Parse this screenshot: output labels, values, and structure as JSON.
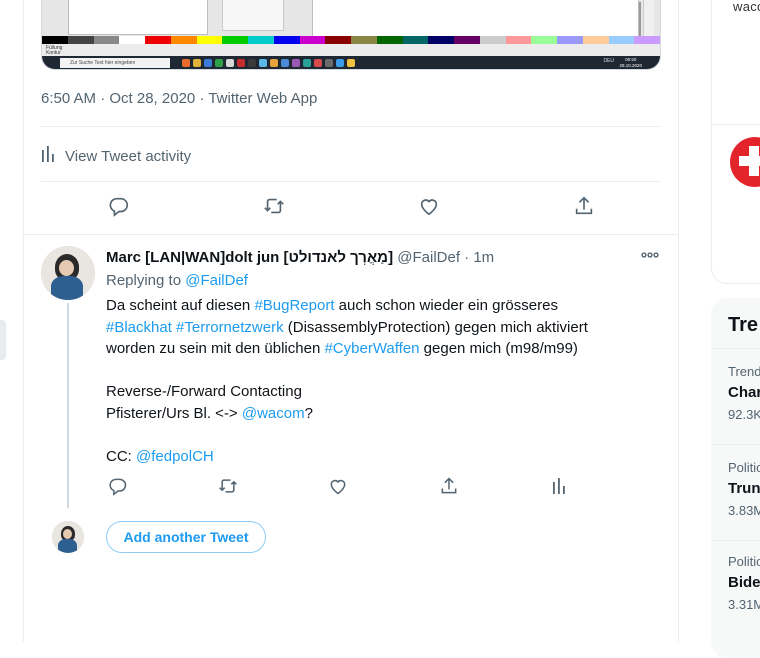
{
  "tweet": {
    "timestamp": "6:50 AM · Oct 28, 2020",
    "source": "Twitter Web App",
    "activity_label": "View Tweet activity"
  },
  "embedded_screenshot": {
    "status_line1": "Füllung",
    "status_line2": "Kontur",
    "taskbar_search_placeholder": "Zur Suche Text hier eingeben",
    "tray_text": "DEU",
    "clock_time": "06:50",
    "clock_date": "28.10.2020"
  },
  "reply": {
    "name": "Marc [LAN|WAN]dolt jun [מַאֲרְך לאנדולט]",
    "handle": "@FailDef",
    "dot": "·",
    "time": "1m",
    "replying_prefix": "Replying to",
    "replying_to": "@FailDef",
    "text": {
      "l1_a": "Da scheint auf diesen ",
      "l1_tag": "#BugReport",
      "l1_b": " auch schon wieder ein grösseres",
      "l2_tag1": "#Blackhat",
      "l2_sp": " ",
      "l2_tag2": "#Terrornetzwerk",
      "l2_b": " (DisassemblyProtection) gegen mich aktiviert",
      "l3_a": "worden zu sein mit den üblichen ",
      "l3_tag": "#CyberWaffen",
      "l3_b": " gegen mich (m98/m99)",
      "l4": "Reverse-/Forward Contacting",
      "l5_a": "Pfisterer/Urs Bl. <-> ",
      "l5_mention": "@wacom",
      "l5_b": "?",
      "l6_a": "CC: ",
      "l6_mention": "@fedpolCH"
    }
  },
  "add_tweet_button": "Add another Tweet",
  "sidebar": {
    "promo_text": "wacom",
    "trends_title": "Tre",
    "trends": [
      {
        "category": "Trend",
        "topic": "Char",
        "count": "92.3K"
      },
      {
        "category": "Politic",
        "topic": "Trun",
        "count": "3.83M"
      },
      {
        "category": "Politic",
        "topic": "Bide",
        "count": "3.31M"
      }
    ]
  },
  "colors": {
    "accent": "#1d9bf0",
    "secondary_text": "#536471",
    "primary_text": "#0f1419",
    "border": "#ebeef0",
    "swiss_red": "#e3242b"
  }
}
